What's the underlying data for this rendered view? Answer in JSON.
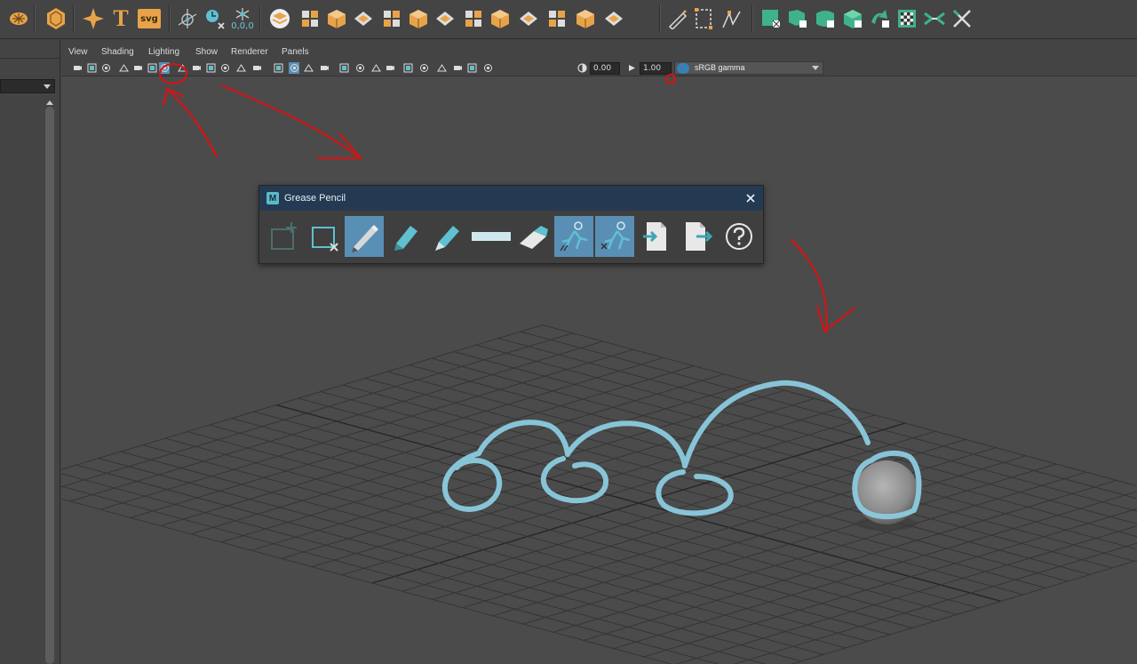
{
  "menu": {
    "items": [
      "View",
      "Shading",
      "Lighting",
      "Show",
      "Renderer",
      "Panels"
    ]
  },
  "shelf": {
    "coord_readout": "0,0,0",
    "svg_label": "svg",
    "text_tool_glyph": "T"
  },
  "panel_toolbar": {
    "exposure_value": "0.00",
    "gamma_value": "1.00",
    "color_space": "sRGB gamma"
  },
  "grease_pencil": {
    "title": "Grease Pencil",
    "logo_letter": "M",
    "tools": [
      {
        "icon": "add-frame-icon",
        "active": false
      },
      {
        "icon": "delete-frame-icon",
        "active": false
      },
      {
        "icon": "pencil-icon",
        "active": true
      },
      {
        "icon": "marker-icon",
        "active": false
      },
      {
        "icon": "soft-pencil-icon",
        "active": false
      },
      {
        "icon": "line-width-icon",
        "active": false
      },
      {
        "icon": "eraser-icon",
        "active": false
      },
      {
        "icon": "ghost-previous-icon",
        "active": true
      },
      {
        "icon": "ghost-next-icon",
        "active": true
      },
      {
        "icon": "import-icon",
        "active": false
      },
      {
        "icon": "export-icon",
        "active": false
      },
      {
        "icon": "help-icon",
        "active": false
      }
    ]
  },
  "colors": {
    "accent_orange": "#e8a349",
    "accent_teal": "#5fc0d0",
    "active_tool_bg": "#5a8fb5",
    "stroke_color": "#8ccbe0",
    "annotation_red": "#e01010"
  }
}
